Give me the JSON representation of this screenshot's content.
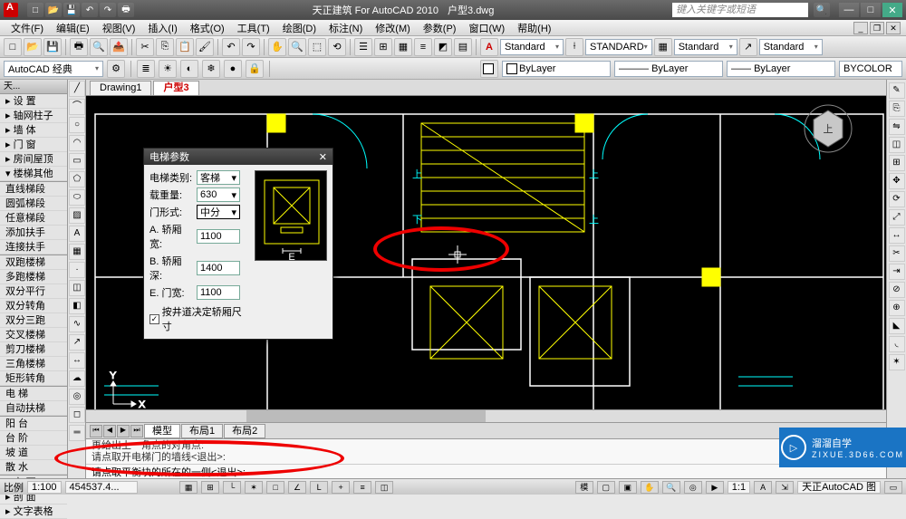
{
  "app": {
    "title_prefix": "天正建筑 For AutoCAD 2010",
    "document": "户型3.dwg",
    "search_placeholder": "键入关键字或短语"
  },
  "menus": [
    "文件(F)",
    "编辑(E)",
    "视图(V)",
    "插入(I)",
    "格式(O)",
    "工具(T)",
    "绘图(D)",
    "标注(N)",
    "修改(M)",
    "参数(P)",
    "窗口(W)",
    "帮助(H)"
  ],
  "workspace": "AutoCAD 经典",
  "style_combos": {
    "text_style": "Standard",
    "dim_style": "STANDARD",
    "table_style": "Standard",
    "mleader_style": "Standard"
  },
  "layer_props": {
    "color": "ByLayer",
    "linetype": "ByLayer",
    "lineweight": "ByLayer",
    "plot_style": "BYCOLOR"
  },
  "doc_tabs": [
    {
      "label": "Drawing1",
      "active": false
    },
    {
      "label": "户型3",
      "active": true
    }
  ],
  "left_palette": {
    "title": "天...",
    "groups": [
      [
        "▸ 设    置",
        "▸ 轴网柱子",
        "▸ 墙    体",
        "▸ 门    窗",
        "▸ 房间屋顶",
        "▾ 楼梯其他"
      ],
      [
        "直线梯段",
        "圆弧梯段",
        "任意梯段",
        "添加扶手",
        "连接扶手"
      ],
      [
        "双跑楼梯",
        "多跑楼梯",
        "双分平行",
        "双分转角",
        "双分三跑",
        "交叉楼梯",
        "剪刀楼梯",
        "三角楼梯",
        "矩形转角"
      ],
      [
        "电    梯",
        "自动扶梯"
      ],
      [
        "阳    台",
        "台    阶",
        "坡    道",
        "散    水"
      ],
      [
        "▸ 立    面",
        "▸ 剖    面",
        "▸ 文字表格"
      ]
    ]
  },
  "dialog": {
    "title": "电梯参数",
    "fields": {
      "type_label": "电梯类别:",
      "type_value": "客梯",
      "load_label": "载重量:",
      "load_value": "630",
      "door_label": "门形式:",
      "door_value": "中分",
      "cabw_label": "A. 轿厢宽:",
      "cabw_value": "1100",
      "cabd_label": "B. 轿厢深:",
      "cabd_value": "1400",
      "doorw_label": "E. 门宽:",
      "doorw_value": "1100"
    },
    "checkbox": "按井道决定轿厢尺寸",
    "checked": true,
    "preview_label": "E"
  },
  "layout_tabs": [
    "模型",
    "布局1",
    "布局2"
  ],
  "command": {
    "history": [
      "再给出上一角点的对角点:",
      "请点取开电梯门的墙线<退出>:"
    ],
    "prompt": "请点取平衡块的所在的一侧<退出>:"
  },
  "status": {
    "scale_label": "比例",
    "scale_value": "1:100",
    "coords": "454537.4...",
    "toggles": [
      "捕捉",
      "栅格",
      "正交",
      "极轴",
      "对象捕",
      "对象追",
      "DUCS",
      "DYN",
      "线宽",
      "QP"
    ],
    "right": "天正AutoCAD 图",
    "annoscale": "1:1"
  },
  "watermark": {
    "main": "溜溜自学",
    "sub": "ZIXUE.3D66.COM"
  },
  "colors": {
    "accent_red": "#e00000",
    "brand_blue": "#1a74c4",
    "cad_yellow": "#ffff00",
    "cad_cyan": "#00ffff",
    "cad_white": "#ffffff"
  }
}
